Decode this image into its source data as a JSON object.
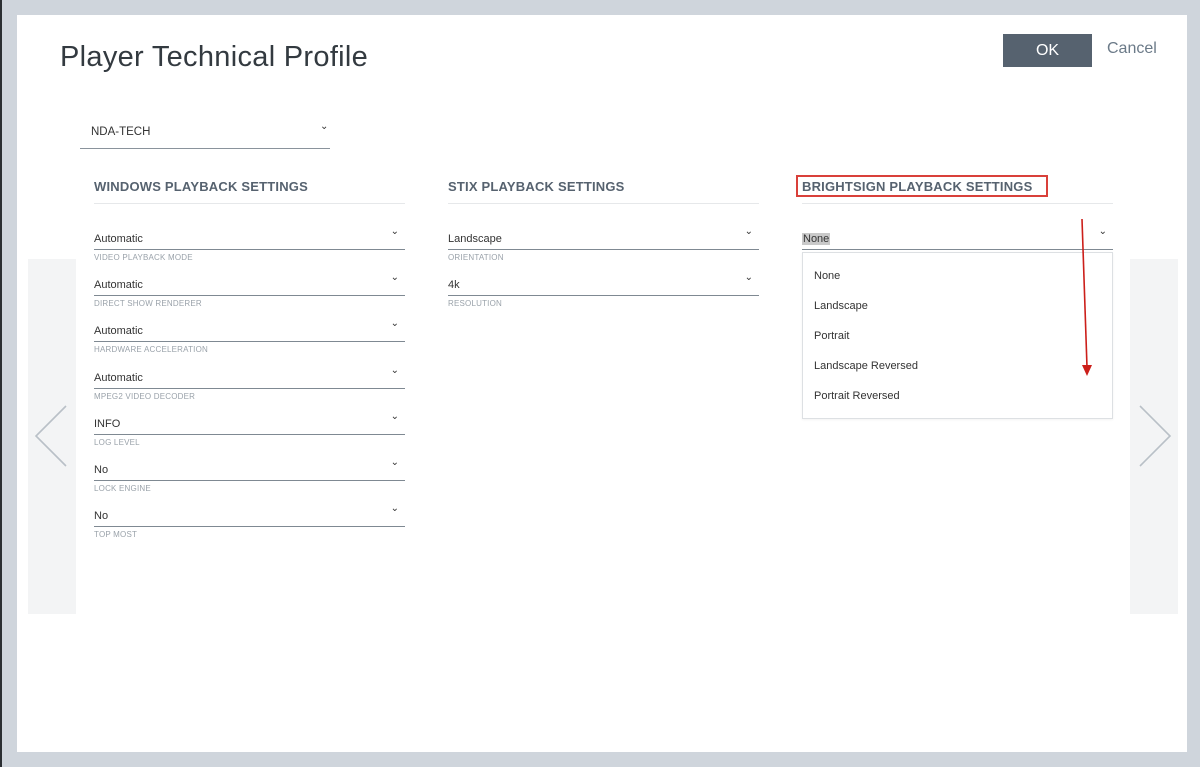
{
  "dialog": {
    "title": "Player Technical Profile",
    "ok_label": "OK",
    "cancel_label": "Cancel"
  },
  "profile": {
    "selected": "NDA-TECH"
  },
  "windows": {
    "title": "WINDOWS PLAYBACK SETTINGS",
    "fields": [
      {
        "value": "Automatic",
        "label": "VIDEO PLAYBACK MODE"
      },
      {
        "value": "Automatic",
        "label": "DIRECT SHOW RENDERER"
      },
      {
        "value": "Automatic",
        "label": "HARDWARE ACCELERATION"
      },
      {
        "value": "Automatic",
        "label": "MPEG2 VIDEO DECODER"
      },
      {
        "value": "INFO",
        "label": "LOG LEVEL"
      },
      {
        "value": "No",
        "label": "LOCK ENGINE"
      },
      {
        "value": "No",
        "label": "TOP MOST"
      }
    ]
  },
  "stix": {
    "title": "STIX PLAYBACK SETTINGS",
    "fields": [
      {
        "value": "Landscape",
        "label": "ORIENTATION"
      },
      {
        "value": "4k",
        "label": "RESOLUTION"
      }
    ]
  },
  "brightsign": {
    "title": "BRIGHTSIGN PLAYBACK SETTINGS",
    "selected": "None",
    "options": [
      "None",
      "Landscape",
      "Portrait",
      "Landscape Reversed",
      "Portrait Reversed"
    ]
  },
  "colors": {
    "primary_button": "#56626f",
    "highlight_box": "#d9403a",
    "annotation_arrow": "#cc1f1a"
  },
  "icons": {
    "dropdown": "chevron-down-icon",
    "prev": "chevron-left-icon",
    "next": "chevron-right-icon"
  }
}
